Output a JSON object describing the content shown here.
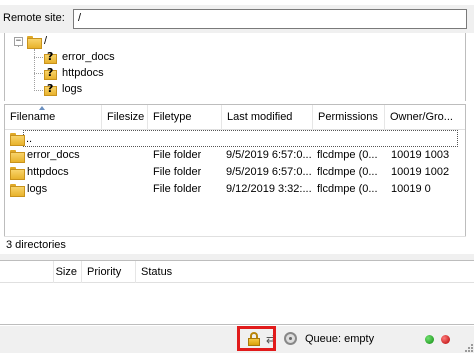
{
  "remote_site": {
    "label": "Remote site:",
    "path": "/"
  },
  "tree": {
    "root": {
      "label": "/",
      "expander": "−"
    },
    "children": [
      {
        "label": "error_docs",
        "icon": "unknown-folder-icon"
      },
      {
        "label": "httpdocs",
        "icon": "unknown-folder-icon"
      },
      {
        "label": "logs",
        "icon": "unknown-folder-icon"
      }
    ]
  },
  "file_list": {
    "columns": {
      "filename": "Filename",
      "filesize": "Filesize",
      "filetype": "Filetype",
      "modified": "Last modified",
      "permissions": "Permissions",
      "owner": "Owner/Gro..."
    },
    "parent_row": {
      "name": ".."
    },
    "rows": [
      {
        "name": "error_docs",
        "size": "",
        "type": "File folder",
        "modified": "9/5/2019 6:57:0...",
        "permissions": "flcdmpe (0...",
        "owner": "10019 1003"
      },
      {
        "name": "httpdocs",
        "size": "",
        "type": "File folder",
        "modified": "9/5/2019 6:57:0...",
        "permissions": "flcdmpe (0...",
        "owner": "10019 1002"
      },
      {
        "name": "logs",
        "size": "",
        "type": "File folder",
        "modified": "9/12/2019 3:32:...",
        "permissions": "flcdmpe (0...",
        "owner": "10019 0"
      }
    ],
    "summary": "3 directories"
  },
  "queue": {
    "columns": {
      "size": "Size",
      "priority": "Priority",
      "status": "Status"
    }
  },
  "statusbar": {
    "queue_text": "Queue: empty",
    "icons": [
      "lock-icon",
      "sync-icon",
      "filter-icon"
    ],
    "highlight_color": "#e11b1b",
    "led_colors": {
      "receive": "#118a11",
      "send": "#b30000"
    }
  }
}
